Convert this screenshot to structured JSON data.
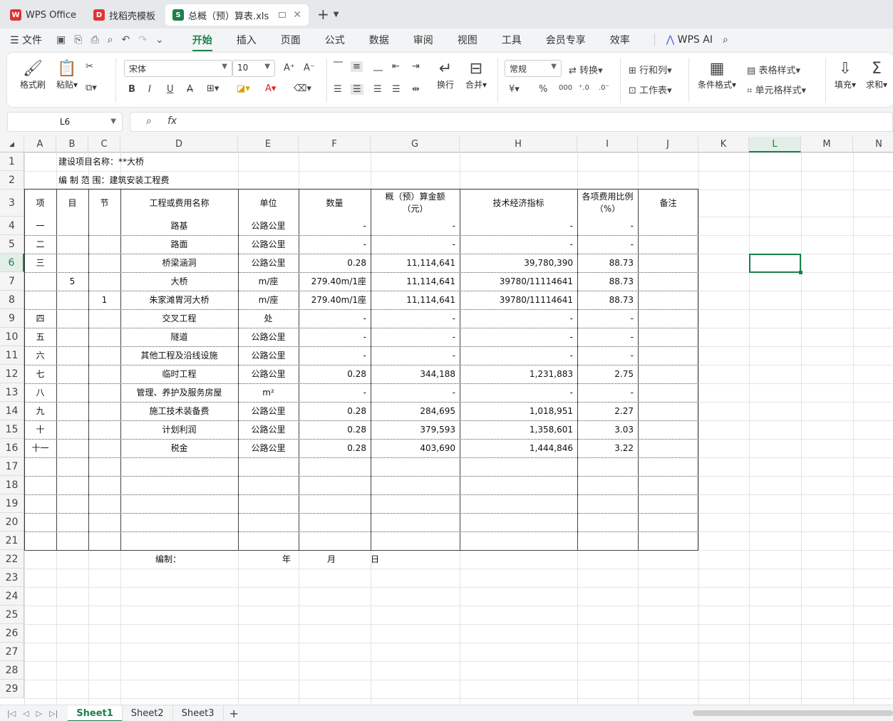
{
  "tabs": [
    {
      "label": "WPS Office",
      "icon": "wps-logo-icon",
      "color": "#e03434"
    },
    {
      "label": "找稻壳模板",
      "icon": "docer-icon",
      "color": "#e03434"
    },
    {
      "label": "总概（预）算表.xls",
      "icon": "sheet-icon",
      "color": "#1a7f4b"
    }
  ],
  "menu": {
    "file": "文件",
    "items": [
      "开始",
      "插入",
      "页面",
      "公式",
      "数据",
      "审阅",
      "视图",
      "工具",
      "会员专享",
      "效率"
    ],
    "active": "开始",
    "ai": "WPS AI"
  },
  "ribbon": {
    "format_painter": "格式刷",
    "paste": "粘贴",
    "font_name": "宋体",
    "font_size": "10",
    "wrap": "换行",
    "merge": "合并",
    "number_format": "常规",
    "convert": "转换",
    "row_col": "行和列",
    "worksheet": "工作表",
    "cond_format": "条件格式",
    "table_style": "表格样式",
    "cell_style": "单元格样式",
    "fill": "填充",
    "sum": "求和"
  },
  "formula_bar": {
    "name_box": "L6",
    "formula": ""
  },
  "columns": [
    "A",
    "B",
    "C",
    "D",
    "E",
    "F",
    "G",
    "H",
    "I",
    "J",
    "K",
    "L",
    "M",
    "N"
  ],
  "selected_col": "L",
  "rows": [
    "1",
    "2",
    "3",
    "4",
    "5",
    "6",
    "7",
    "8",
    "9",
    "10",
    "11",
    "12",
    "13",
    "14",
    "15",
    "16",
    "17",
    "18",
    "19",
    "20",
    "21",
    "22",
    "23",
    "24",
    "25",
    "26",
    "27",
    "28",
    "29"
  ],
  "selected_row": "6",
  "sheet": {
    "title1": "建设项目名称：**大桥",
    "title2": "编 制 范 围：建筑安装工程费",
    "headers": {
      "xiang": "项",
      "mu": "目",
      "jie": "节",
      "name": "工程或费用名称",
      "unit": "单位",
      "qty": "数量",
      "amount": "概（预）算金额",
      "amount_unit": "（元）",
      "index": "技术经济指标",
      "ratio": "各项费用比例",
      "ratio_unit": "（%）",
      "note": "备注"
    },
    "data": [
      {
        "xiang": "一",
        "mu": "",
        "jie": "",
        "name": "路基",
        "unit": "公路公里",
        "qty": "-",
        "amount": "-",
        "index": "-",
        "ratio": "-"
      },
      {
        "xiang": "二",
        "mu": "",
        "jie": "",
        "name": "路面",
        "unit": "公路公里",
        "qty": "-",
        "amount": "-",
        "index": "-",
        "ratio": "-"
      },
      {
        "xiang": "三",
        "mu": "",
        "jie": "",
        "name": "桥梁涵洞",
        "unit": "公路公里",
        "qty": "0.28",
        "amount": "11,114,641",
        "index": "39,780,390",
        "ratio": "88.73"
      },
      {
        "xiang": "",
        "mu": "5",
        "jie": "",
        "name": "大桥",
        "unit": "m/座",
        "qty": "279.40m/1座",
        "amount": "11,114,641",
        "index": "39780/11114641",
        "ratio": "88.73"
      },
      {
        "xiang": "",
        "mu": "",
        "jie": "1",
        "name": "朱家滩胃河大桥",
        "unit": "m/座",
        "qty": "279.40m/1座",
        "amount": "11,114,641",
        "index": "39780/11114641",
        "ratio": "88.73"
      },
      {
        "xiang": "四",
        "mu": "",
        "jie": "",
        "name": "交叉工程",
        "unit": "处",
        "qty": "-",
        "amount": "-",
        "index": "-",
        "ratio": "-"
      },
      {
        "xiang": "五",
        "mu": "",
        "jie": "",
        "name": "隧道",
        "unit": "公路公里",
        "qty": "-",
        "amount": "-",
        "index": "-",
        "ratio": "-"
      },
      {
        "xiang": "六",
        "mu": "",
        "jie": "",
        "name": "其他工程及沿线设施",
        "unit": "公路公里",
        "qty": "-",
        "amount": "-",
        "index": "-",
        "ratio": "-"
      },
      {
        "xiang": "七",
        "mu": "",
        "jie": "",
        "name": "临时工程",
        "unit": "公路公里",
        "qty": "0.28",
        "amount": "344,188",
        "index": "1,231,883",
        "ratio": "2.75"
      },
      {
        "xiang": "八",
        "mu": "",
        "jie": "",
        "name": "管理、养护及服务房屋",
        "unit": "m²",
        "qty": "-",
        "amount": "-",
        "index": "-",
        "ratio": "-"
      },
      {
        "xiang": "九",
        "mu": "",
        "jie": "",
        "name": "施工技术装备费",
        "unit": "公路公里",
        "qty": "0.28",
        "amount": "284,695",
        "index": "1,018,951",
        "ratio": "2.27"
      },
      {
        "xiang": "十",
        "mu": "",
        "jie": "",
        "name": "计划利润",
        "unit": "公路公里",
        "qty": "0.28",
        "amount": "379,593",
        "index": "1,358,601",
        "ratio": "3.03"
      },
      {
        "xiang": "十一",
        "mu": "",
        "jie": "",
        "name": "税金",
        "unit": "公路公里",
        "qty": "0.28",
        "amount": "403,690",
        "index": "1,444,846",
        "ratio": "3.22"
      }
    ],
    "footer": {
      "prepared": "编制：",
      "year": "年",
      "month": "月",
      "day": "日"
    }
  },
  "sheet_tabs": [
    "Sheet1",
    "Sheet2",
    "Sheet3"
  ],
  "active_sheet": "Sheet1",
  "colors": {
    "accent": "#1a7f4b"
  }
}
